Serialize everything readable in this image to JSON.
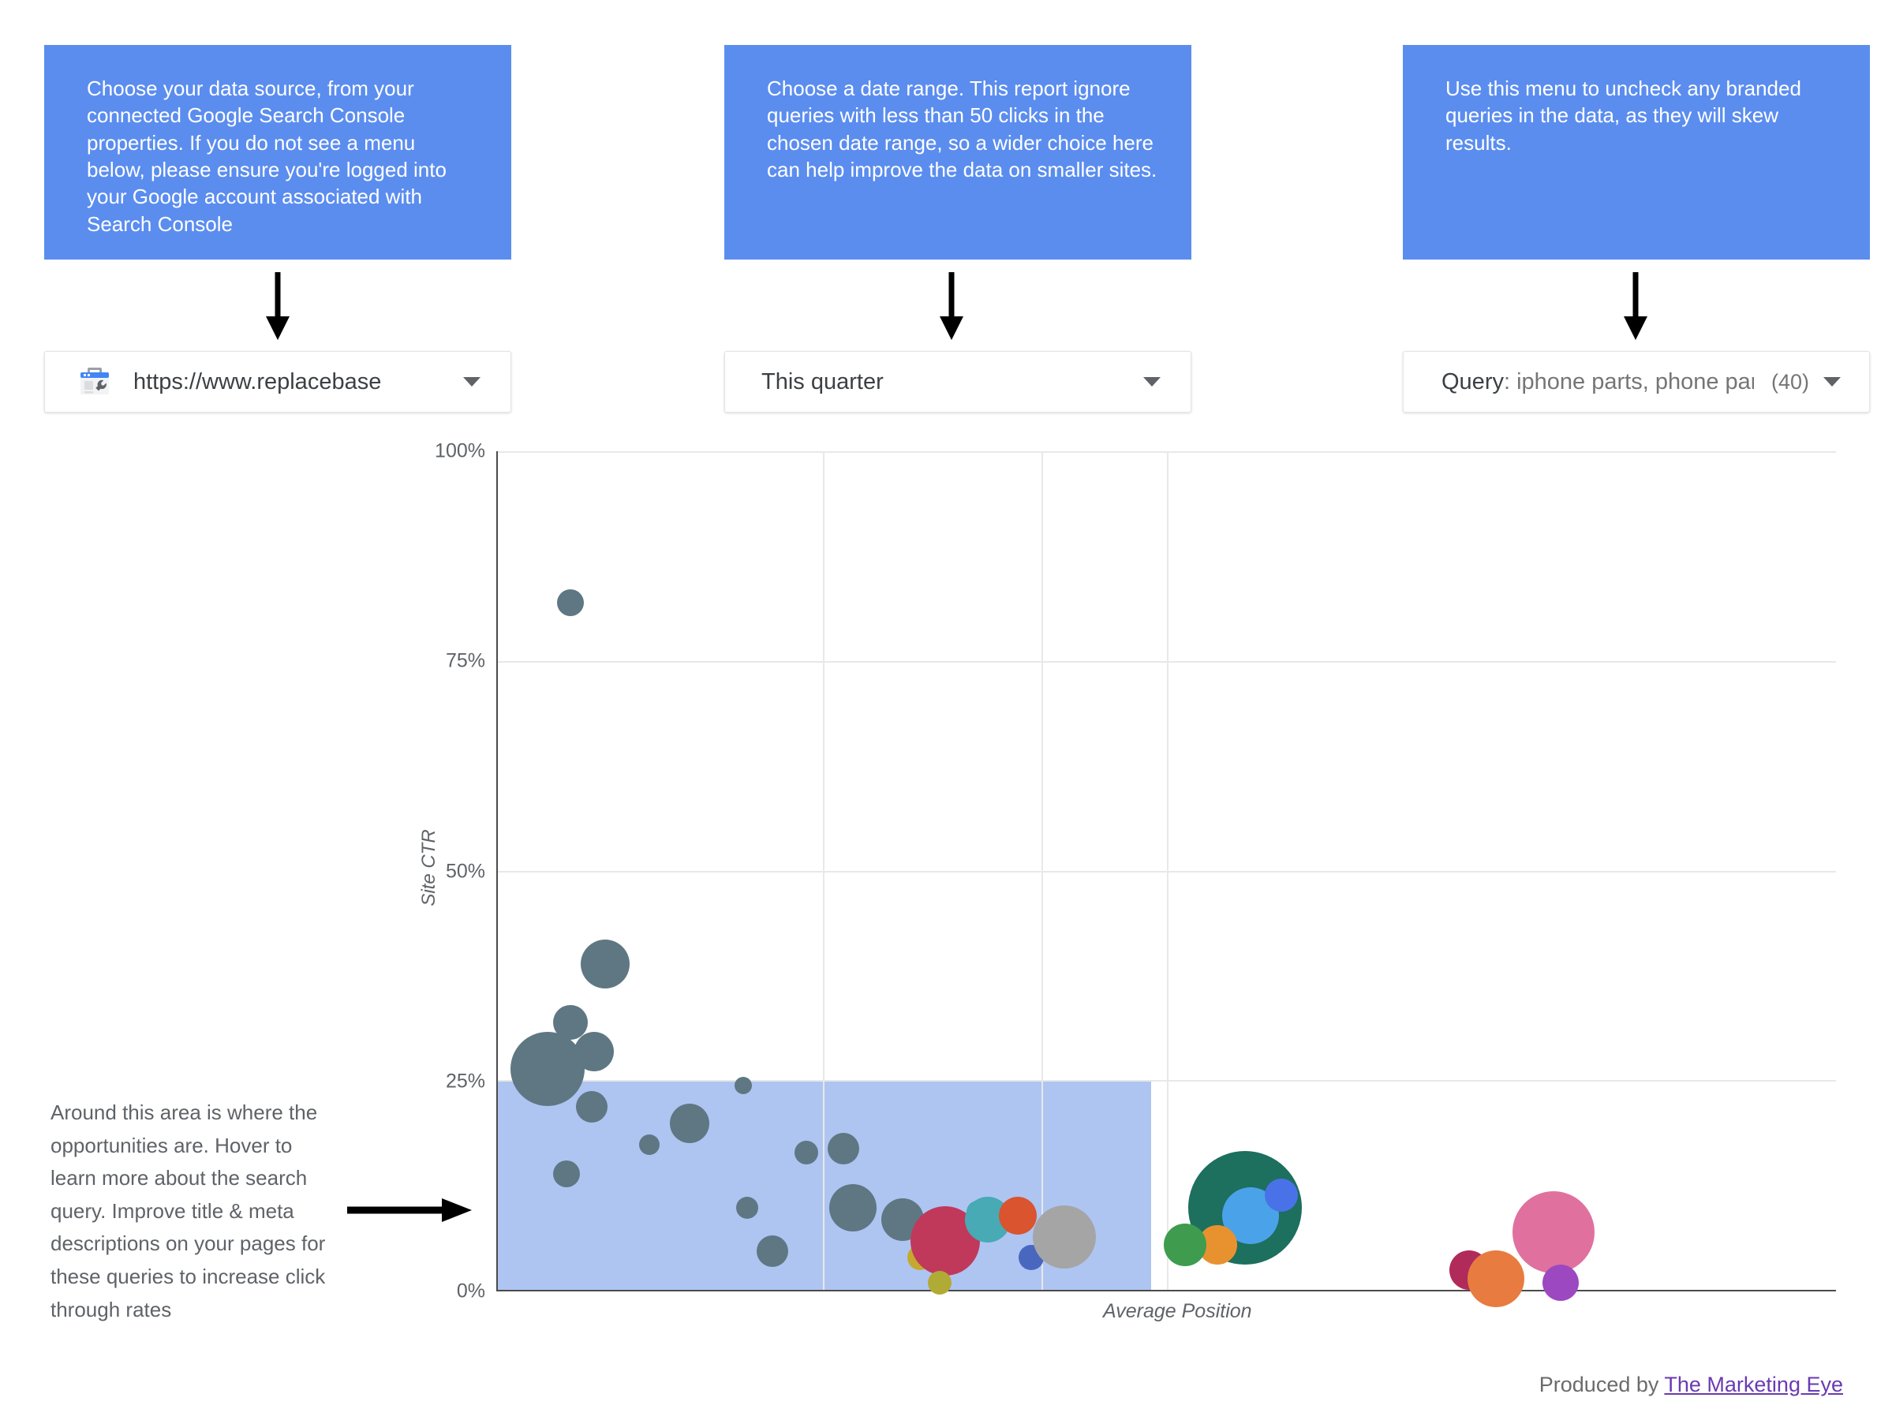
{
  "callouts": [
    {
      "id": "data-source",
      "text": "Choose your data source, from your connected Google Search Console properties. If you do not see a menu below, please ensure you're logged into your Google account associated with Search Console"
    },
    {
      "id": "date-range",
      "text": "Choose a date range. This report ignore queries with less than 50 clicks in the chosen date range, so a wider choice here can help improve the data on smaller sites."
    },
    {
      "id": "query-filter",
      "text": "Use this menu to uncheck any branded queries in the data, as they will skew results."
    }
  ],
  "controls": {
    "data_source": {
      "icon": "search-console-icon",
      "value": "https://www.replacebase",
      "caret": "chevron-down-icon"
    },
    "date_range": {
      "value": "This quarter",
      "caret": "chevron-down-icon"
    },
    "query_filter": {
      "label": "Query",
      "value": ": iphone parts, phone parts…",
      "count": "(40)",
      "caret": "chevron-down-icon"
    }
  },
  "annotation": {
    "text": "Around this area is where the opportunities are. Hover to learn more about the search query. Improve title & meta descriptions on your pages for these queries to increase click through rates"
  },
  "footer": {
    "prefix": "Produced by ",
    "link": "The Marketing Eye"
  },
  "colors": {
    "callout_blue": "#5b8def",
    "band_blue": "#aec5f2",
    "slate": "#5f7783",
    "link_purple": "#6a3ab2"
  },
  "chart_data": {
    "type": "scatter",
    "title": "",
    "xlabel": "Average Position",
    "ylabel": "Site CTR",
    "ytick_labels": [
      "0%",
      "25%",
      "50%",
      "75%",
      "100%"
    ],
    "ytick_values": [
      0,
      25,
      50,
      75,
      100
    ],
    "ylim": [
      0,
      100
    ],
    "xlim": [
      0,
      100
    ],
    "grid": "both",
    "legend": "none",
    "x_gridlines_pct": [
      24.3,
      40.6,
      50.0
    ],
    "highlight_band": {
      "label": "opportunity-zone",
      "y_range": [
        0,
        25
      ],
      "x_range": [
        0,
        48.8
      ],
      "color": "#aec5f2"
    },
    "bubbles": [
      {
        "x": 5.4,
        "y": 82.0,
        "r": 17,
        "color": "#5f7783"
      },
      {
        "x": 8.0,
        "y": 39.0,
        "r": 31,
        "color": "#5f7783"
      },
      {
        "x": 5.4,
        "y": 32.0,
        "r": 22,
        "color": "#5f7783"
      },
      {
        "x": 7.2,
        "y": 28.5,
        "r": 25,
        "color": "#5f7783"
      },
      {
        "x": 3.7,
        "y": 26.5,
        "r": 47,
        "color": "#5f7783"
      },
      {
        "x": 7.0,
        "y": 22.0,
        "r": 20,
        "color": "#5f7783"
      },
      {
        "x": 5.1,
        "y": 14.0,
        "r": 17,
        "color": "#5f7783"
      },
      {
        "x": 11.3,
        "y": 17.5,
        "r": 13,
        "color": "#5f7783"
      },
      {
        "x": 14.3,
        "y": 20.0,
        "r": 25,
        "color": "#5f7783"
      },
      {
        "x": 18.3,
        "y": 24.5,
        "r": 11,
        "color": "#5f7783"
      },
      {
        "x": 18.6,
        "y": 10.0,
        "r": 14,
        "color": "#5f7783"
      },
      {
        "x": 20.5,
        "y": 4.8,
        "r": 20,
        "color": "#5f7783"
      },
      {
        "x": 23.0,
        "y": 16.5,
        "r": 15,
        "color": "#5f7783"
      },
      {
        "x": 25.8,
        "y": 17.0,
        "r": 20,
        "color": "#5f7783"
      },
      {
        "x": 26.5,
        "y": 10.0,
        "r": 30,
        "color": "#5f7783"
      },
      {
        "x": 30.2,
        "y": 8.5,
        "r": 27,
        "color": "#5f7783"
      },
      {
        "x": 31.5,
        "y": 4.0,
        "r": 16,
        "color": "#c4a92e"
      },
      {
        "x": 33.4,
        "y": 6.0,
        "r": 44,
        "color": "#c0395b"
      },
      {
        "x": 33.0,
        "y": 1.0,
        "r": 15,
        "color": "#b0ab35"
      },
      {
        "x": 35.8,
        "y": 9.5,
        "r": 14,
        "color": "#47aab4"
      },
      {
        "x": 36.6,
        "y": 8.5,
        "r": 29,
        "color": "#47aab4"
      },
      {
        "x": 38.8,
        "y": 9.0,
        "r": 24,
        "color": "#d9542f"
      },
      {
        "x": 39.8,
        "y": 4.0,
        "r": 16,
        "color": "#4a67c0"
      },
      {
        "x": 42.3,
        "y": 6.5,
        "r": 40,
        "color": "#a5a5a5"
      },
      {
        "x": 55.8,
        "y": 10.0,
        "r": 72,
        "color": "#1d6f5e"
      },
      {
        "x": 56.2,
        "y": 9.0,
        "r": 36,
        "color": "#4aa3e8"
      },
      {
        "x": 58.5,
        "y": 11.5,
        "r": 21,
        "color": "#4a72e8"
      },
      {
        "x": 53.7,
        "y": 5.5,
        "r": 25,
        "color": "#e8922f"
      },
      {
        "x": 51.3,
        "y": 5.5,
        "r": 27,
        "color": "#3f9c4e"
      },
      {
        "x": 72.5,
        "y": 2.5,
        "r": 25,
        "color": "#b02a5a"
      },
      {
        "x": 74.5,
        "y": 1.5,
        "r": 36,
        "color": "#e87b3f"
      },
      {
        "x": 78.8,
        "y": 7.0,
        "r": 52,
        "color": "#e0719e"
      },
      {
        "x": 79.3,
        "y": 1.0,
        "r": 23,
        "color": "#9c48c0"
      }
    ]
  }
}
